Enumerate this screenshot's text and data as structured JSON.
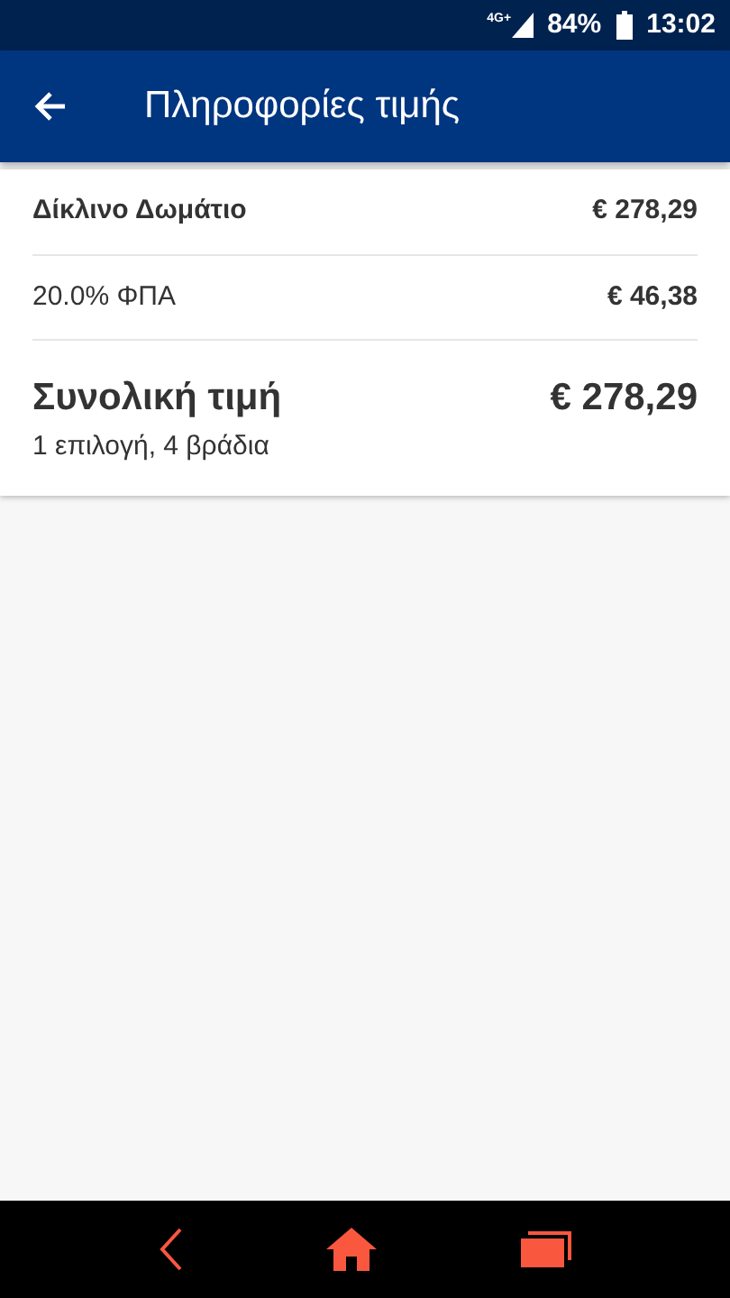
{
  "status_bar": {
    "network": "4G+",
    "battery": "84%",
    "time": "13:02"
  },
  "app_bar": {
    "title": "Πληροφορίες τιμής"
  },
  "price_lines": [
    {
      "kind": "item",
      "label": "Δίκλινο Δωμάτιο",
      "amount": "€ 278,29"
    },
    {
      "kind": "tax",
      "label": "20.0% ΦΠΑ",
      "amount": "€ 46,38"
    }
  ],
  "total": {
    "label": "Συνολική τιμή",
    "amount": "€ 278,29",
    "detail": "1 επιλογή, 4 βράδια"
  }
}
